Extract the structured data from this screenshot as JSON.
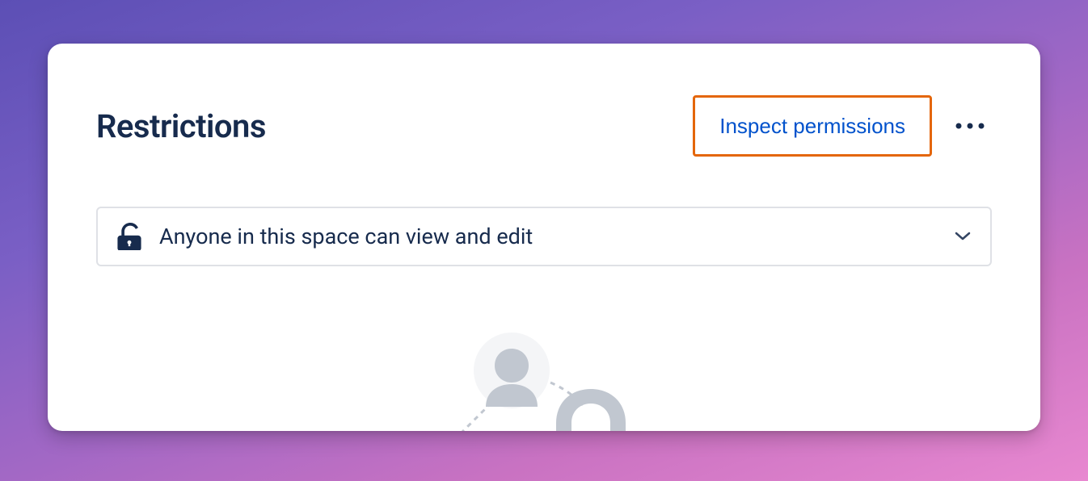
{
  "header": {
    "title": "Restrictions",
    "inspect_label": "Inspect permissions"
  },
  "dropdown": {
    "selected_label": "Anyone in this space can view and edit"
  }
}
